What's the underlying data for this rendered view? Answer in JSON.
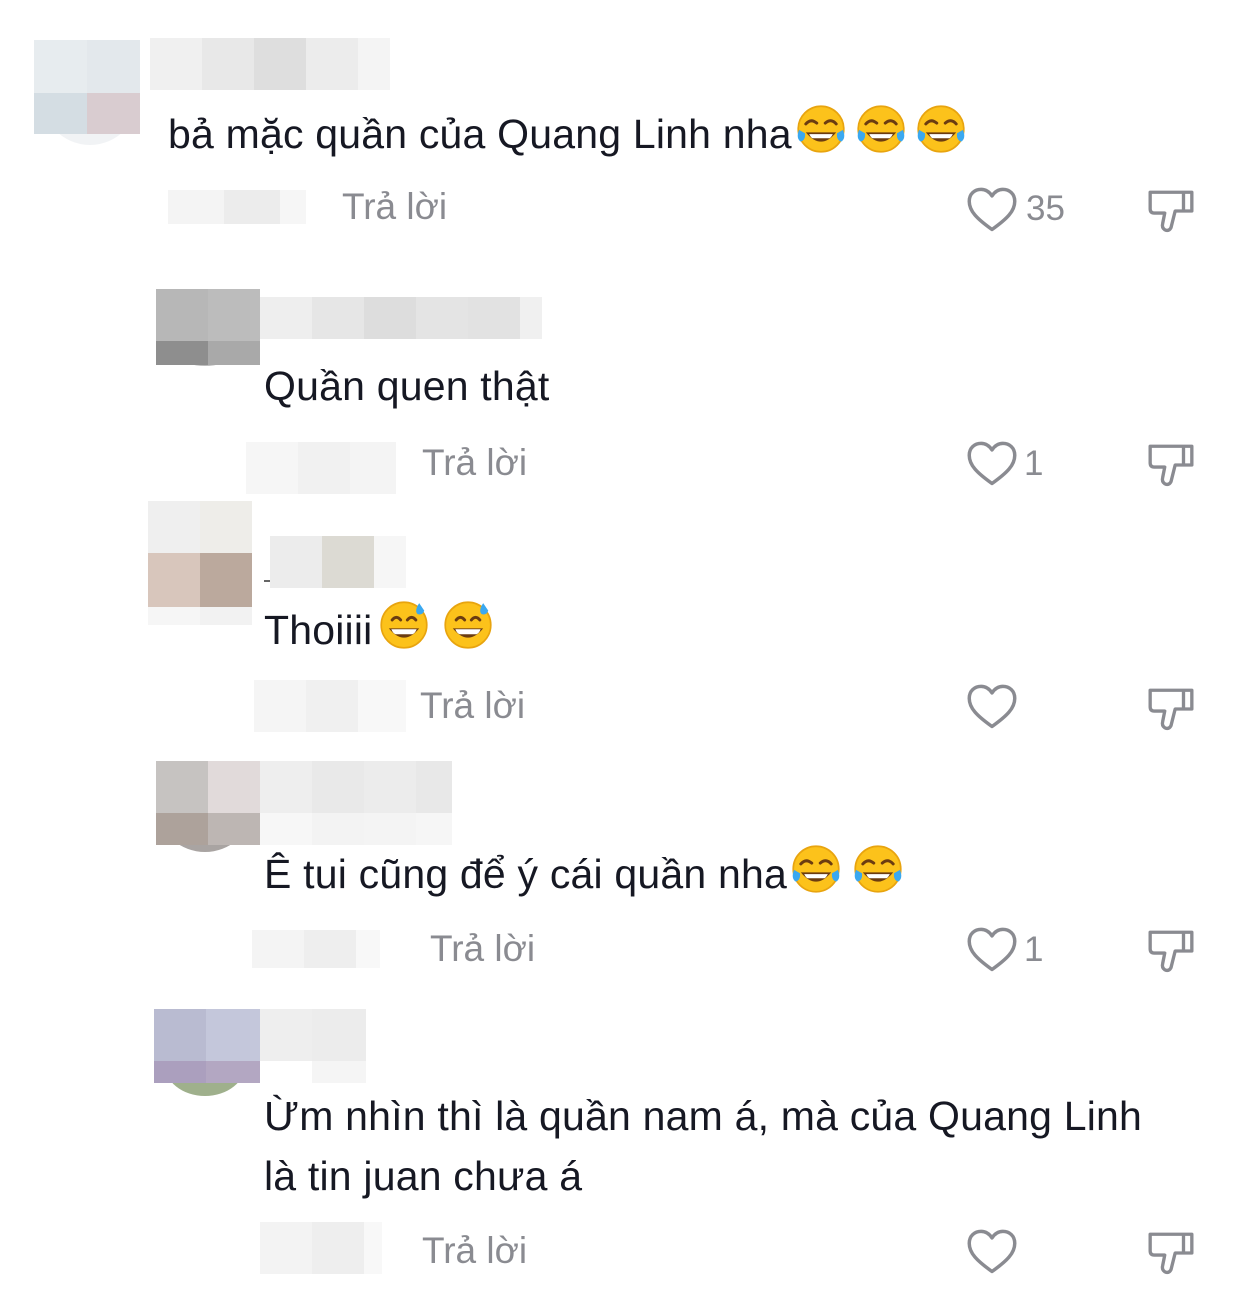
{
  "comments": [
    {
      "text": "bả mặc quần của Quang Linh nha",
      "emojis": [
        "face-with-tears-of-joy-icon",
        "face-with-tears-of-joy-icon",
        "face-with-tears-of-joy-icon"
      ],
      "reply_label": "Trả lời",
      "likes": "35"
    },
    {
      "text": "Quần quen thật",
      "emojis": [],
      "reply_label": "Trả lời",
      "likes": "1"
    },
    {
      "text": "Thoiiii",
      "emojis": [
        "grinning-face-with-sweat-icon",
        "grinning-face-with-sweat-icon"
      ],
      "reply_label": "Trả lời",
      "likes": ""
    },
    {
      "text": "Ê tui cũng để ý cái quần nha",
      "emojis": [
        "face-with-tears-of-joy-icon",
        "face-with-tears-of-joy-icon"
      ],
      "reply_label": "Trả lời",
      "likes": "1"
    },
    {
      "text": "Ừm nhìn thì là quần nam á, mà của Quang Linh là tin juan chưa á",
      "emojis": [],
      "reply_label": "Trả lời",
      "likes": ""
    }
  ],
  "icons": {
    "like": "heart-outline-icon",
    "dislike": "thumbs-down-outline-icon"
  },
  "colors": {
    "text": "#161823",
    "secondary": "#8a8b91",
    "background": "#ffffff"
  }
}
